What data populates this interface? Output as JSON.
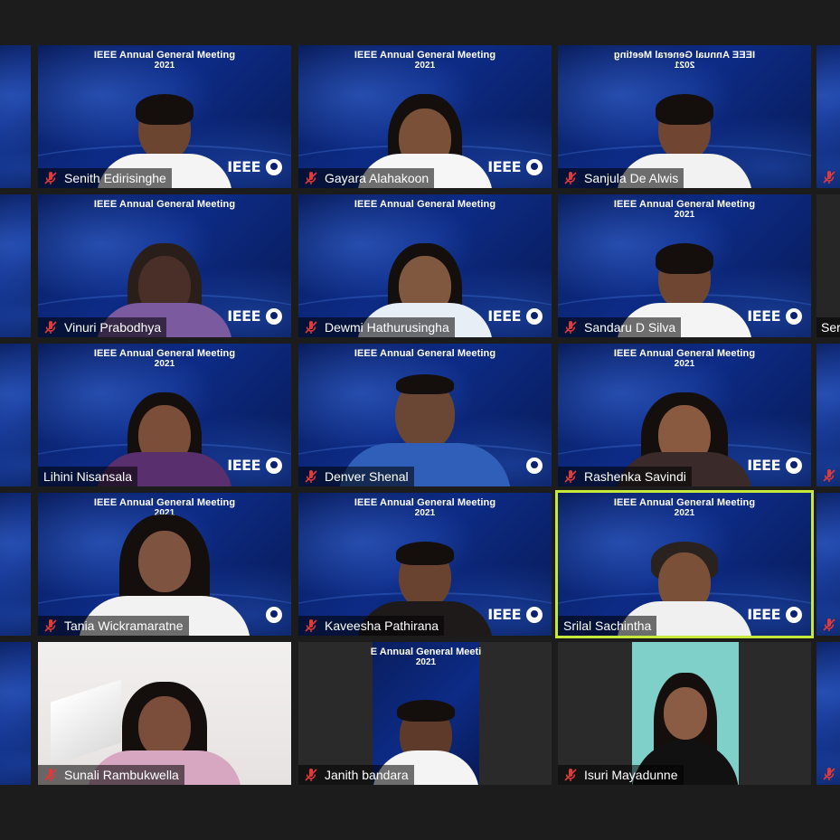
{
  "meeting_banner": {
    "title": "IEEE Annual General Meeting",
    "year": "2021"
  },
  "mirrored_banner": {
    "title": "IEEE Annual General Meeting",
    "year": "2021"
  },
  "ieee_logo_text": "IEEE",
  "cropped_banner": {
    "title": "E Annual General Meeti",
    "year": "2021"
  },
  "colors": {
    "active_speaker_border": "#c6e83a",
    "mic_muted": "#e03a3a",
    "tile_background": "#0d2b86"
  },
  "participants": [
    {
      "name": "Senith Edirisinghe",
      "muted": true
    },
    {
      "name": "Gayara Alahakoon",
      "muted": true
    },
    {
      "name": "Sanjula De Alwis",
      "muted": true
    },
    {
      "name": "Vinuri Prabodhya",
      "muted": true
    },
    {
      "name": "Dewmi Hathurusingha",
      "muted": true
    },
    {
      "name": "Sandaru D Silva",
      "muted": true
    },
    {
      "name": "Lihini Nisansala",
      "muted": false
    },
    {
      "name": "Denver Shenal",
      "muted": true
    },
    {
      "name": "Rashenka Savindi",
      "muted": true
    },
    {
      "name": "Tania Wickramaratne",
      "muted": true
    },
    {
      "name": "Kaveesha Pathirana",
      "muted": true
    },
    {
      "name": "Srilal Sachintha",
      "muted": false,
      "active_speaker": true
    },
    {
      "name": "Sunali Rambukwella",
      "muted": true
    },
    {
      "name": "Janith bandara",
      "muted": true
    },
    {
      "name": "Isuri Mayadunne",
      "muted": true
    }
  ],
  "edge_fragments": {
    "right_row2_name": "Ser"
  }
}
